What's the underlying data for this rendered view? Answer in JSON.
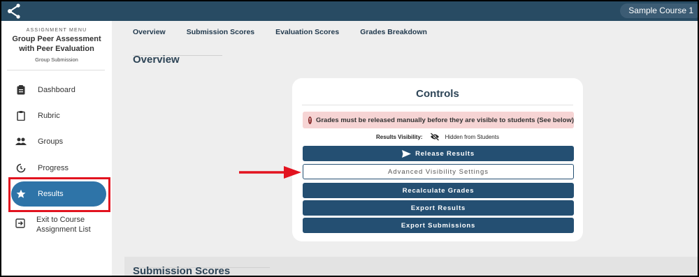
{
  "topbar": {
    "course_name": "Sample Course 1"
  },
  "sidebar": {
    "menu_label": "ASSIGNMENT MENU",
    "assignment_title": "Group Peer Assessment with Peer Evaluation",
    "assignment_type": "Group Submission",
    "items": [
      {
        "label": "Dashboard",
        "icon": "clipboard-icon"
      },
      {
        "label": "Rubric",
        "icon": "rubric-icon"
      },
      {
        "label": "Groups",
        "icon": "people-icon"
      },
      {
        "label": "Progress",
        "icon": "progress-icon"
      },
      {
        "label": "Results",
        "icon": "star-icon",
        "active": true
      },
      {
        "label": "Exit to Course Assignment List",
        "icon": "exit-icon"
      }
    ]
  },
  "tabs": [
    "Overview",
    "Submission Scores",
    "Evaluation Scores",
    "Grades Breakdown"
  ],
  "main": {
    "overview_title": "Overview",
    "submission_scores_title": "Submission Scores"
  },
  "controls": {
    "title": "Controls",
    "alert_text": "Grades must be released manually before they are visible to students (See below)",
    "visibility_label": "Results Visibility:",
    "visibility_value": "Hidden from Students",
    "buttons": {
      "release": "Release Results",
      "advanced": "Advanced Visibility Settings",
      "recalculate": "Recalculate Grades",
      "export_results": "Export Results",
      "export_submissions": "Export Submissions"
    }
  },
  "colors": {
    "topbar": "#284b63",
    "primary_button": "#244f72",
    "active_nav": "#2e74a8",
    "alert_bg": "#f6d4d4",
    "annotation_red": "#e2131f"
  }
}
